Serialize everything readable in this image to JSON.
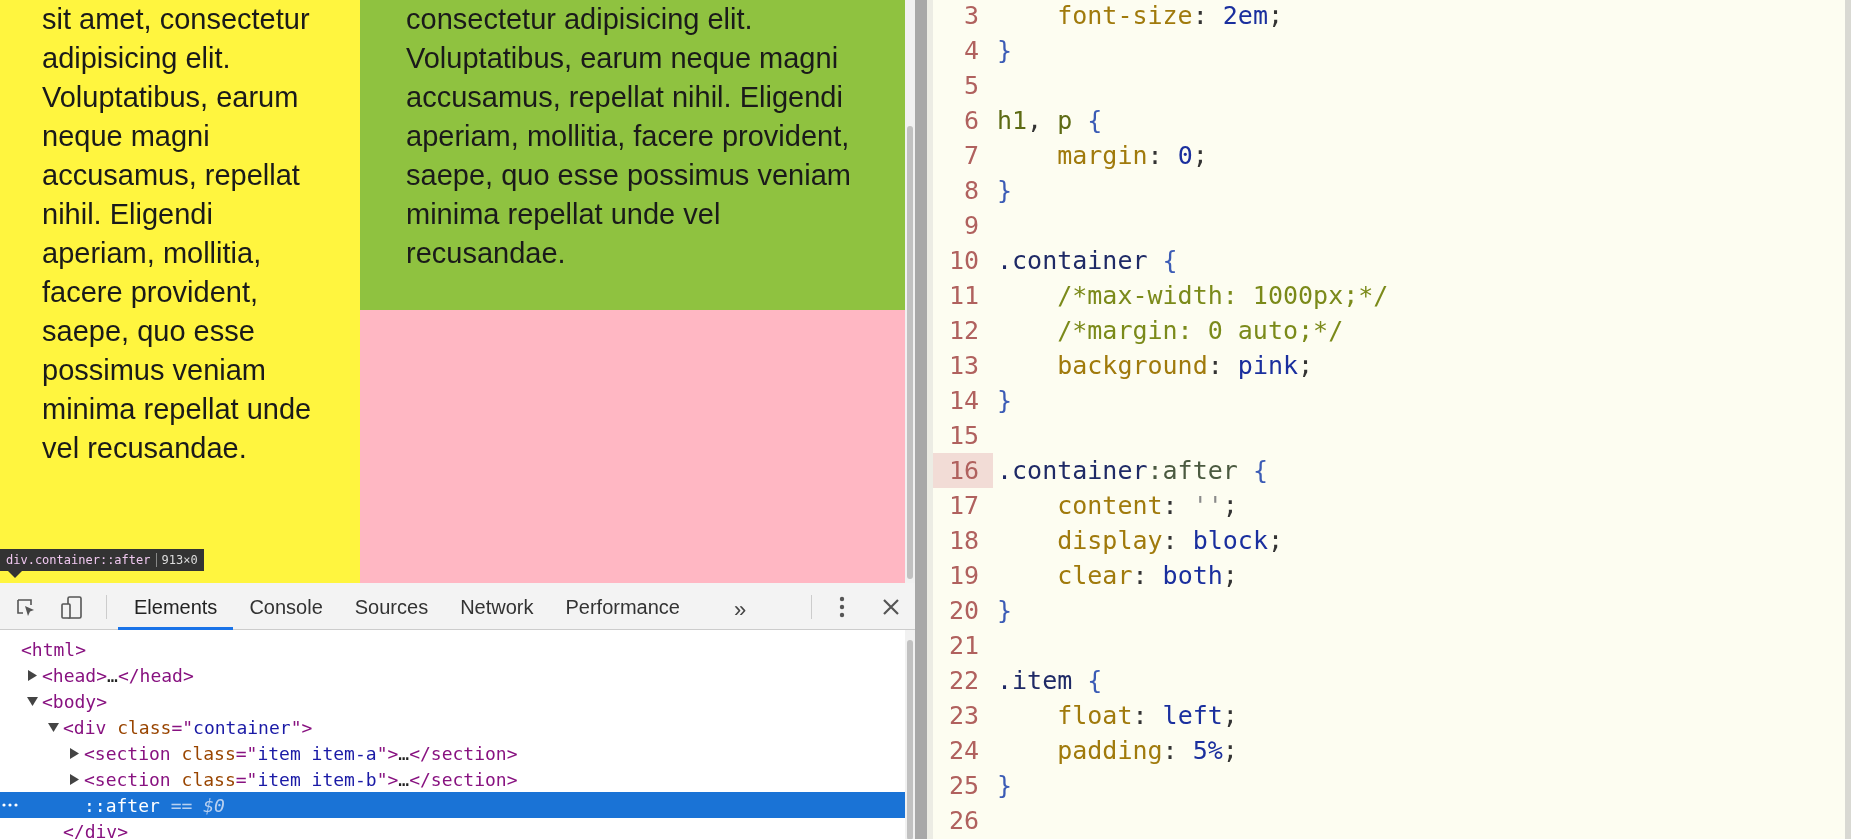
{
  "browser_page": {
    "column_a": {
      "text": "sit amet, consectetur adipisicing elit. Voluptatibus, earum neque magni accusamus, repellat nihil. Eligendi aperiam, mollitia, facere provident, saepe, quo esse possimus veniam minima repellat unde vel recusandae."
    },
    "column_b": {
      "text": "consectetur adipisicing elit. Voluptatibus, earum neque magni accusamus, repellat nihil. Eligendi aperiam, mollitia, facere provident, saepe, quo esse possimus veniam minima repellat unde vel recusandae."
    },
    "element_tooltip": {
      "selector": "div.container::after",
      "size": "913×0"
    }
  },
  "devtools": {
    "tabs": [
      {
        "label": "Elements",
        "selected": true
      },
      {
        "label": "Console",
        "selected": false
      },
      {
        "label": "Sources",
        "selected": false
      },
      {
        "label": "Network",
        "selected": false
      },
      {
        "label": "Performance",
        "selected": false
      }
    ],
    "more_tabs": "»",
    "dom_tree": [
      {
        "tokens": [
          {
            "kind": "tag",
            "text": "<html>"
          }
        ],
        "selected": false,
        "children": [
          {
            "tokens": [
              {
                "kind": "tag",
                "text": "<head>"
              },
              {
                "kind": "text",
                "text": "…"
              },
              {
                "kind": "tag",
                "text": "</head>"
              }
            ],
            "expanded": false,
            "selected": false
          },
          {
            "tokens": [
              {
                "kind": "tag",
                "text": "<body>"
              }
            ],
            "expanded": true,
            "selected": false,
            "children": [
              {
                "tokens": [
                  {
                    "kind": "tag",
                    "text": "<div"
                  },
                  {
                    "kind": "attr",
                    "text": " class"
                  },
                  {
                    "kind": "tag",
                    "text": "=\""
                  },
                  {
                    "kind": "value",
                    "text": "container"
                  },
                  {
                    "kind": "tag",
                    "text": "\">"
                  }
                ],
                "expanded": true,
                "selected": false,
                "closing": [
                  {
                    "kind": "tag",
                    "text": "</div>"
                  }
                ],
                "children": [
                  {
                    "tokens": [
                      {
                        "kind": "tag",
                        "text": "<section"
                      },
                      {
                        "kind": "attr",
                        "text": " class"
                      },
                      {
                        "kind": "tag",
                        "text": "=\""
                      },
                      {
                        "kind": "value",
                        "text": "item item-a"
                      },
                      {
                        "kind": "tag",
                        "text": "\">"
                      },
                      {
                        "kind": "text",
                        "text": "…"
                      },
                      {
                        "kind": "tag",
                        "text": "</section>"
                      }
                    ],
                    "expanded": false,
                    "selected": false
                  },
                  {
                    "tokens": [
                      {
                        "kind": "tag",
                        "text": "<section"
                      },
                      {
                        "kind": "attr",
                        "text": " class"
                      },
                      {
                        "kind": "tag",
                        "text": "=\""
                      },
                      {
                        "kind": "value",
                        "text": "item item-b"
                      },
                      {
                        "kind": "tag",
                        "text": "\">"
                      },
                      {
                        "kind": "text",
                        "text": "…"
                      },
                      {
                        "kind": "tag",
                        "text": "</section>"
                      }
                    ],
                    "expanded": false,
                    "selected": false
                  },
                  {
                    "tokens": [
                      {
                        "kind": "pseudo",
                        "text": "::after"
                      },
                      {
                        "kind": "hint",
                        "text": " == $0"
                      }
                    ],
                    "selected": true
                  }
                ]
              }
            ]
          }
        ]
      }
    ]
  },
  "editor": {
    "lines": [
      {
        "number": "3",
        "current": false,
        "tokens": [
          {
            "kind": "property",
            "text": "    font-size"
          },
          {
            "kind": "punct",
            "text": ": "
          },
          {
            "kind": "value",
            "text": "2em"
          },
          {
            "kind": "punct",
            "text": ";"
          }
        ]
      },
      {
        "number": "4",
        "current": false,
        "tokens": [
          {
            "kind": "brace",
            "text": "}"
          }
        ]
      },
      {
        "number": "5",
        "current": false
      },
      {
        "number": "6",
        "current": false,
        "tokens": [
          {
            "kind": "tagsel",
            "text": "h1"
          },
          {
            "kind": "punct",
            "text": ", "
          },
          {
            "kind": "tagsel",
            "text": "p"
          },
          {
            "kind": "brace",
            "text": " {"
          }
        ]
      },
      {
        "number": "7",
        "current": false,
        "tokens": [
          {
            "kind": "property",
            "text": "    margin"
          },
          {
            "kind": "punct",
            "text": ": "
          },
          {
            "kind": "value",
            "text": "0"
          },
          {
            "kind": "punct",
            "text": ";"
          }
        ]
      },
      {
        "number": "8",
        "current": false,
        "tokens": [
          {
            "kind": "brace",
            "text": "}"
          }
        ]
      },
      {
        "number": "9",
        "current": false
      },
      {
        "number": "10",
        "current": false,
        "tokens": [
          {
            "kind": "selector",
            "text": ".container"
          },
          {
            "kind": "brace",
            "text": " {"
          }
        ]
      },
      {
        "number": "11",
        "current": false,
        "tokens": [
          {
            "kind": "comment",
            "text": "    /*max-width: 1000px;*/"
          }
        ]
      },
      {
        "number": "12",
        "current": false,
        "tokens": [
          {
            "kind": "comment",
            "text": "    /*margin: 0 auto;*/"
          }
        ]
      },
      {
        "number": "13",
        "current": false,
        "tokens": [
          {
            "kind": "property",
            "text": "    background"
          },
          {
            "kind": "punct",
            "text": ": "
          },
          {
            "kind": "value",
            "text": "pink"
          },
          {
            "kind": "punct",
            "text": ";"
          }
        ]
      },
      {
        "number": "14",
        "current": false,
        "tokens": [
          {
            "kind": "brace",
            "text": "}"
          }
        ]
      },
      {
        "number": "15",
        "current": false
      },
      {
        "number": "16",
        "current": true,
        "tokens": [
          {
            "kind": "selector",
            "text": ".container"
          },
          {
            "kind": "pseudo",
            "text": ":after"
          },
          {
            "kind": "brace",
            "text": " {"
          }
        ]
      },
      {
        "number": "17",
        "current": false,
        "tokens": [
          {
            "kind": "property",
            "text": "    content"
          },
          {
            "kind": "punct",
            "text": ": "
          },
          {
            "kind": "string",
            "text": "''"
          },
          {
            "kind": "punct",
            "text": ";"
          }
        ]
      },
      {
        "number": "18",
        "current": false,
        "tokens": [
          {
            "kind": "property",
            "text": "    display"
          },
          {
            "kind": "punct",
            "text": ": "
          },
          {
            "kind": "value",
            "text": "block"
          },
          {
            "kind": "punct",
            "text": ";"
          }
        ]
      },
      {
        "number": "19",
        "current": false,
        "tokens": [
          {
            "kind": "property",
            "text": "    clear"
          },
          {
            "kind": "punct",
            "text": ": "
          },
          {
            "kind": "value",
            "text": "both"
          },
          {
            "kind": "punct",
            "text": ";"
          }
        ]
      },
      {
        "number": "20",
        "current": false,
        "tokens": [
          {
            "kind": "brace",
            "text": "}"
          }
        ]
      },
      {
        "number": "21",
        "current": false
      },
      {
        "number": "22",
        "current": false,
        "tokens": [
          {
            "kind": "selector",
            "text": ".item"
          },
          {
            "kind": "brace",
            "text": " {"
          }
        ]
      },
      {
        "number": "23",
        "current": false,
        "tokens": [
          {
            "kind": "property",
            "text": "    float"
          },
          {
            "kind": "punct",
            "text": ": "
          },
          {
            "kind": "value",
            "text": "left"
          },
          {
            "kind": "punct",
            "text": ";"
          }
        ]
      },
      {
        "number": "24",
        "current": false,
        "tokens": [
          {
            "kind": "property",
            "text": "    padding"
          },
          {
            "kind": "punct",
            "text": ": "
          },
          {
            "kind": "value",
            "text": "5%"
          },
          {
            "kind": "punct",
            "text": ";"
          }
        ]
      },
      {
        "number": "25",
        "current": false,
        "tokens": [
          {
            "kind": "brace",
            "text": "}"
          }
        ]
      },
      {
        "number": "26",
        "current": false
      }
    ]
  }
}
